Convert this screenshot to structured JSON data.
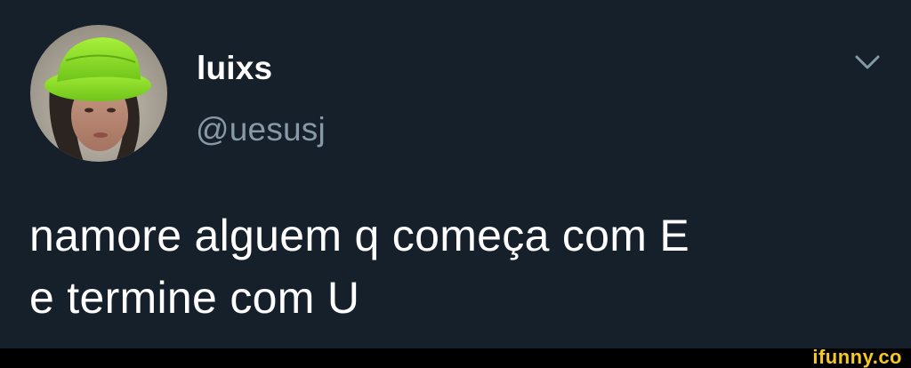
{
  "tweet": {
    "display_name": "luixs",
    "handle": "@uesusj",
    "text": "namore alguem q começa com E\ne termine com U",
    "avatar_icon": "avatar-photo",
    "menu_icon": "chevron-down-icon"
  },
  "watermark": {
    "text": "ifunny.co"
  },
  "colors": {
    "background": "#15202b",
    "text_primary": "#ffffff",
    "text_secondary": "#8899a6",
    "watermark": "#f7c81e"
  }
}
